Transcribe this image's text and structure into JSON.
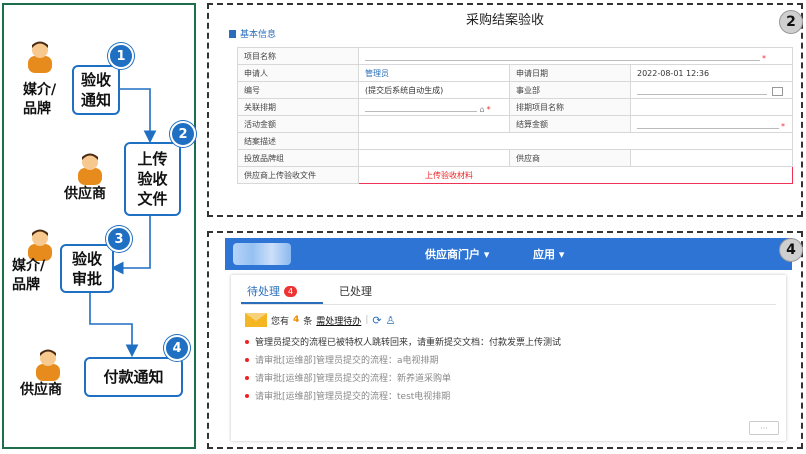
{
  "flow": {
    "actors": [
      "媒介/\n品牌",
      "供应商",
      "媒介/\n品牌",
      "供应商"
    ],
    "steps": [
      {
        "num": "1",
        "label": "验收\n通知"
      },
      {
        "num": "2",
        "label": "上传\n验收\n文件"
      },
      {
        "num": "3",
        "label": "验收\n审批"
      },
      {
        "num": "4",
        "label": "付款通知"
      }
    ]
  },
  "form_panel": {
    "badge": "2",
    "title": "采购结案验收",
    "section": "基本信息",
    "rows": [
      {
        "l1": "项目名称",
        "v1": "",
        "l2": "",
        "v2": ""
      },
      {
        "l1": "申请人",
        "v1": "管理员",
        "l2": "申请日期",
        "v2": "2022-08-01 12:36"
      },
      {
        "l1": "编号",
        "v1": "(提交后系统自动生成)",
        "l2": "事业部",
        "v2": ""
      },
      {
        "l1": "关联排期",
        "v1": "",
        "l2": "排期项目名称",
        "v2": ""
      },
      {
        "l1": "活动金额",
        "v1": "",
        "l2": "结算金额",
        "v2": ""
      },
      {
        "l1": "结案描述",
        "v1": "",
        "l2": "",
        "v2": ""
      },
      {
        "l1": "投放品牌组",
        "v1": "",
        "l2": "供应商",
        "v2": ""
      },
      {
        "l1": "供应商上传验收文件",
        "v1": "上传验收材料",
        "l2": "",
        "v2": ""
      }
    ]
  },
  "portal_panel": {
    "badge": "4",
    "nav": [
      "供应商门户 ▾",
      "应用 ▾"
    ],
    "tabs": {
      "pending": "待处理",
      "pending_count": "4",
      "done": "已处理"
    },
    "summary": {
      "prefix": "您有",
      "count": "4",
      "unit": "条",
      "link": "需处理待办"
    },
    "messages": [
      "管理员提交的流程已被特权人跳转回来，请重新提交文档：付款发票上传测试",
      "请审批[运维部]管理员提交的流程：a电视排期",
      "请审批[运维部]管理员提交的流程：新养道采购单",
      "请审批[运维部]管理员提交的流程：test电视排期"
    ],
    "more": "···"
  },
  "colors": {
    "accent": "#1f6fc2",
    "nav_bar": "#2e74d4",
    "flow_border": "#1c6e4c",
    "alert": "#e22"
  }
}
